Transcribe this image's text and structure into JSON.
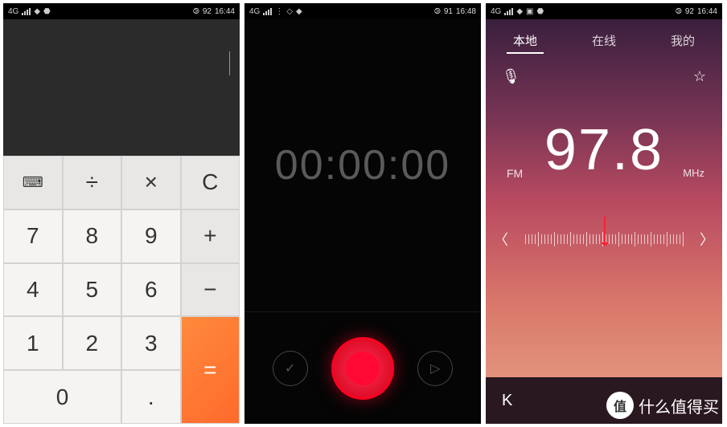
{
  "status": {
    "network": "4G",
    "time_calc": "16:44",
    "time_rec": "16:48",
    "time_radio": "16:44",
    "battery_calc": "92",
    "battery_rec": "91",
    "battery_radio": "92"
  },
  "calculator": {
    "display": "",
    "keys": {
      "calendar_icon": "⌨",
      "divide": "÷",
      "multiply": "×",
      "clear": "C",
      "k7": "7",
      "k8": "8",
      "k9": "9",
      "plus": "+",
      "k4": "4",
      "k5": "5",
      "k6": "6",
      "minus": "−",
      "k1": "1",
      "k2": "2",
      "k3": "3",
      "equals": "=",
      "k0": "0",
      "dot": "."
    }
  },
  "recorder": {
    "timer": "00:00:00",
    "check_icon": "✓",
    "play_icon": "▷"
  },
  "radio": {
    "tabs": {
      "local": "本地",
      "online": "在线",
      "mine": "我的"
    },
    "mic_icon": "🎙",
    "star_icon": "☆",
    "band": "FM",
    "frequency": "97.8",
    "unit": "MHz",
    "arrow_left": "〈",
    "arrow_right": "〉",
    "back_icon": "K"
  },
  "watermark": {
    "badge": "值",
    "text": "什么值得买"
  }
}
